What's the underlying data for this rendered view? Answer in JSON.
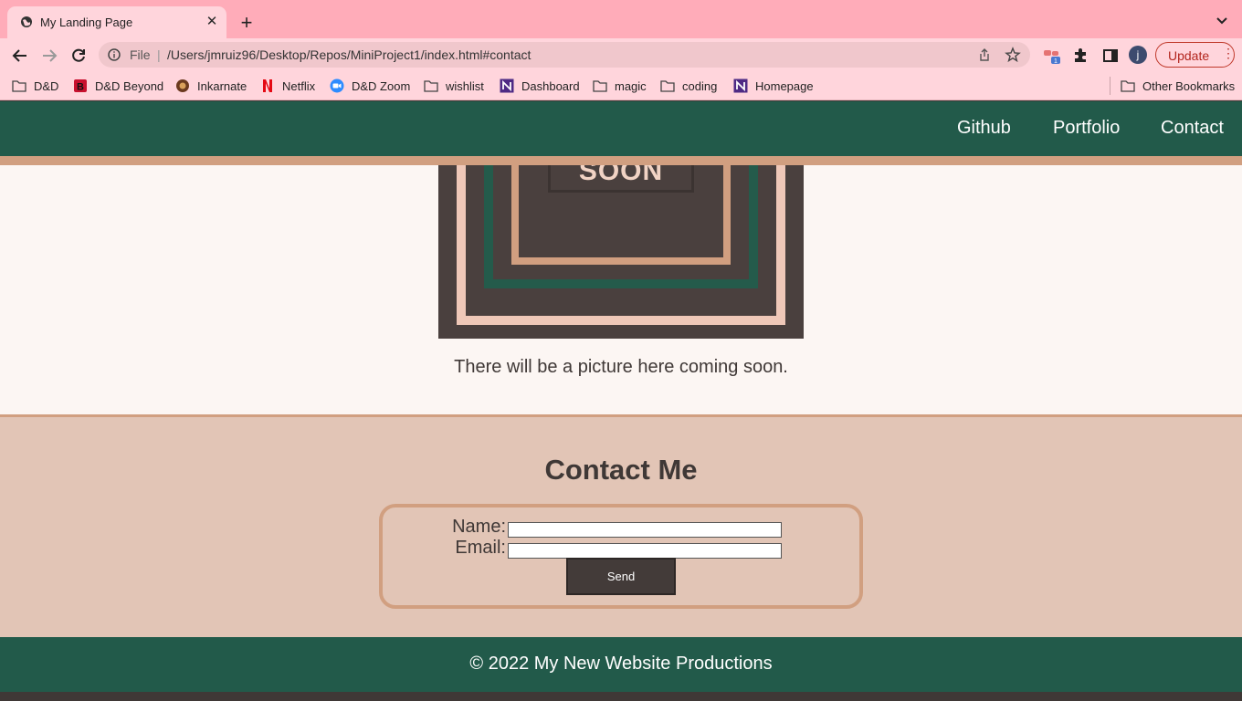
{
  "browser": {
    "tab": {
      "title": "My Landing Page",
      "close": "✕"
    },
    "new_tab": "+",
    "address": {
      "scheme": "File",
      "separator": "|",
      "url": "/Users/jmruiz96/Desktop/Repos/MiniProject1/index.html#contact"
    },
    "profile_initial": "j",
    "update_label": "Update",
    "menu_dots": "⋮",
    "extension_badge": "1",
    "bookmarks": [
      {
        "label": "D&D",
        "icon": "folder-icon"
      },
      {
        "label": "D&D Beyond",
        "icon": "dnd-beyond-icon"
      },
      {
        "label": "Inkarnate",
        "icon": "inkarnate-icon"
      },
      {
        "label": "Netflix",
        "icon": "netflix-icon"
      },
      {
        "label": "D&D Zoom",
        "icon": "zoom-icon"
      },
      {
        "label": "wishlist",
        "icon": "folder-icon"
      },
      {
        "label": "Dashboard",
        "icon": "northwestern-icon"
      },
      {
        "label": "magic",
        "icon": "folder-icon"
      },
      {
        "label": "coding",
        "icon": "folder-icon"
      },
      {
        "label": "Homepage",
        "icon": "northwestern-icon"
      }
    ],
    "other_bookmarks": "Other Bookmarks"
  },
  "site": {
    "nav": {
      "github": "Github",
      "portfolio": "Portfolio",
      "contact": "Contact"
    },
    "placeholder_text": "SOON",
    "caption": "There will be a picture here coming soon.",
    "contact": {
      "title": "Contact Me",
      "name_label": "Name:",
      "email_label": "Email:",
      "name_value": "",
      "email_value": "",
      "send_label": "Send"
    },
    "footer": "© 2022 My New Website Productions"
  },
  "colors": {
    "header_green": "#225a4a",
    "accent_tan": "#d19f80",
    "contact_bg": "#e2c5b6",
    "page_bg": "#fcf6f3",
    "dark": "#3f3836",
    "tab_strip": "#ffacb9",
    "toolbar": "#ffd5dc"
  }
}
